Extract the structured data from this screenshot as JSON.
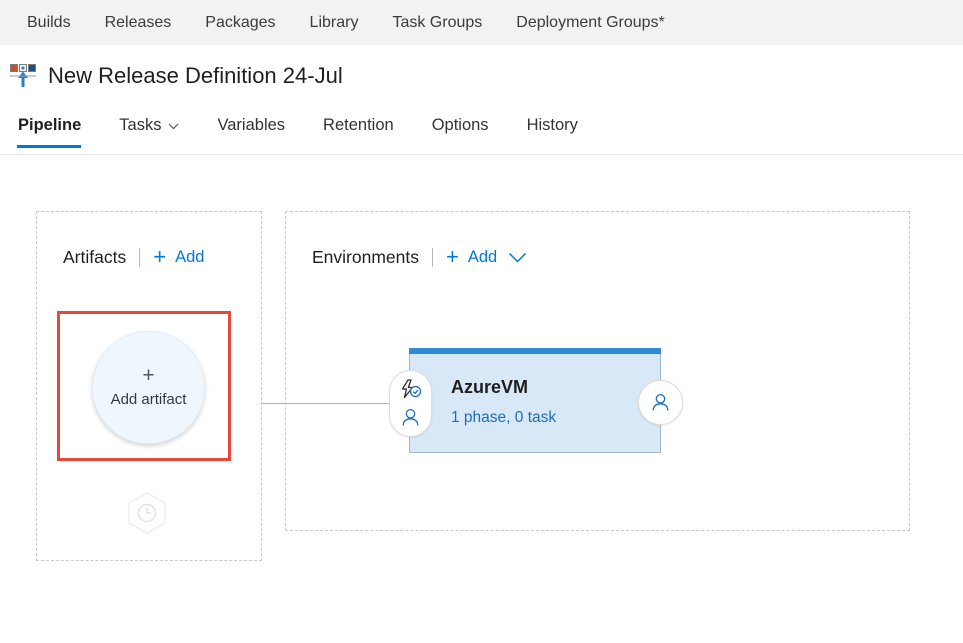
{
  "topnav": {
    "items": [
      {
        "label": "Builds",
        "name": "nav-builds"
      },
      {
        "label": "Releases",
        "name": "nav-releases"
      },
      {
        "label": "Packages",
        "name": "nav-packages"
      },
      {
        "label": "Library",
        "name": "nav-library"
      },
      {
        "label": "Task Groups",
        "name": "nav-task-groups"
      },
      {
        "label": "Deployment Groups*",
        "name": "nav-deployment-groups"
      }
    ]
  },
  "header": {
    "title": "New Release Definition 24-Jul",
    "icon": "release-definition-icon"
  },
  "tabs": [
    {
      "label": "Pipeline",
      "active": true,
      "has_chevron": false
    },
    {
      "label": "Tasks",
      "active": false,
      "has_chevron": true
    },
    {
      "label": "Variables",
      "active": false,
      "has_chevron": false
    },
    {
      "label": "Retention",
      "active": false,
      "has_chevron": false
    },
    {
      "label": "Options",
      "active": false,
      "has_chevron": false
    },
    {
      "label": "History",
      "active": false,
      "has_chevron": false
    }
  ],
  "artifacts": {
    "title": "Artifacts",
    "add_label": "Add",
    "add_plus": "+",
    "node": {
      "plus": "+",
      "label": "Add artifact"
    },
    "schedule_trigger_icon": "clock-icon"
  },
  "environments": {
    "title": "Environments",
    "add_label": "Add",
    "add_plus": "+",
    "add_chevron_icon": "chevron-down-icon",
    "card": {
      "name": "AzureVM",
      "subtitle": "1 phase, 0 task",
      "pre_deployment_conditions_icon": "lightning-check-icon",
      "pre_deployment_approvals_icon": "person-icon",
      "post_deployment_approvals_icon": "person-icon"
    }
  },
  "colors": {
    "accent_blue": "#0078d4",
    "link_blue": "#0078d4",
    "card_topbar_blue": "#2e8bd6",
    "card_body_blue": "#d9e8f7",
    "subtitle_blue": "#1b6fb5",
    "highlight_red": "#e8483a",
    "topnav_background": "#f2f2f2",
    "panel_border": "#c8c8c8"
  }
}
